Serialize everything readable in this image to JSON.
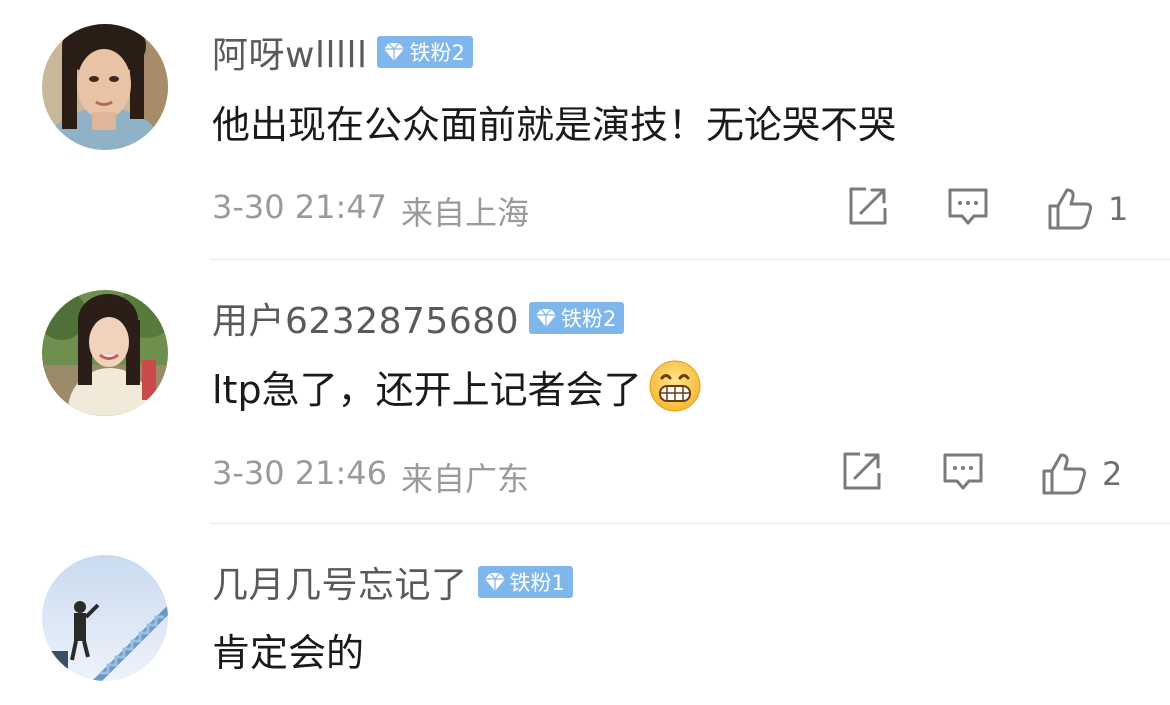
{
  "comments": [
    {
      "username": "阿呀wlllll",
      "badge": "铁粉2",
      "text": "他出现在公众面前就是演技！无论哭不哭",
      "date": "3-30 21:47",
      "location": "来自上海",
      "likes": "1"
    },
    {
      "username": "用户6232875680",
      "badge": "铁粉2",
      "text": "ltp急了，还开上记者会了",
      "emoji": "grinning-face",
      "date": "3-30 21:46",
      "location": "来自广东",
      "likes": "2"
    },
    {
      "username": "几月几号忘记了",
      "badge": "铁粉1",
      "text": "肯定会的"
    }
  ],
  "colors": {
    "badge_bg": "#7fb6ec",
    "username": "#5a5a5a",
    "meta": "#9a9a9a",
    "icon": "#7a7a7a"
  }
}
